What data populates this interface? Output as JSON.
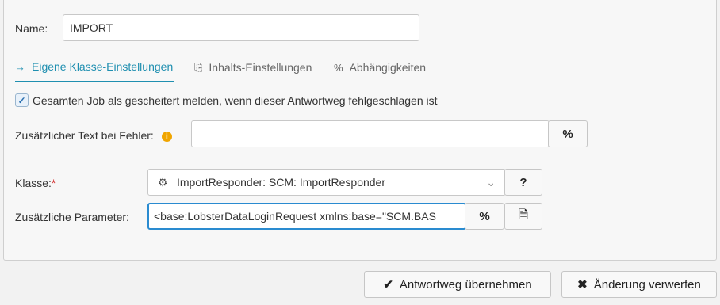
{
  "form": {
    "name_label": "Name:",
    "name_value": "IMPORT",
    "tabs": [
      {
        "icon": "arrow-right-icon",
        "label": "Eigene Klasse-Einstellungen",
        "glyph": "→"
      },
      {
        "icon": "document-icon",
        "label": "Inhalts-Einstellungen",
        "glyph": "⎘"
      },
      {
        "icon": "percent-icon",
        "label": "Abhängigkeiten",
        "glyph": "%"
      }
    ],
    "fail_checkbox_label": "Gesamten Job als gescheitert melden, wenn dieser Antwortweg fehlgeschlagen ist",
    "fail_checkbox_checked": true,
    "error_text_label": "Zusätzlicher Text bei Fehler:",
    "error_text_value": "",
    "class_label": "Klasse:",
    "class_required_mark": "*",
    "class_value": "ImportResponder: SCM: ImportResponder",
    "class_help_glyph": "?",
    "params_label": "Zusätzliche Parameter:",
    "params_value": "<base:LobsterDataLoginRequest xmlns:base=\"SCM.BAS",
    "percent_glyph": "%"
  },
  "footer": {
    "accept_label": "Antwortweg übernehmen",
    "discard_label": "Änderung verwerfen"
  },
  "colors": {
    "accent": "#1f8fb0",
    "focus": "#2a8bd0",
    "required": "#d32f2f",
    "info": "#f0a500"
  }
}
